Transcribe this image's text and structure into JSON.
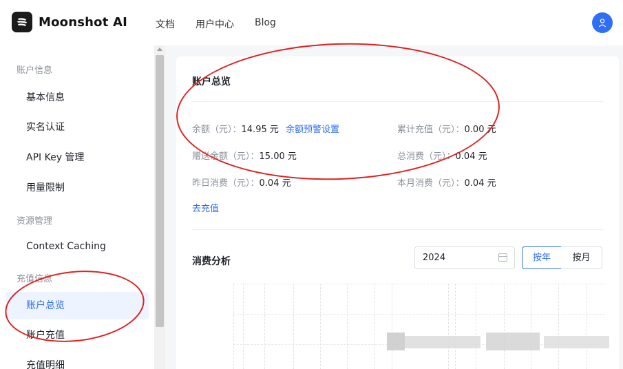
{
  "header": {
    "brand": "Moonshot AI",
    "nav": [
      {
        "label": "文档"
      },
      {
        "label": "用户中心"
      },
      {
        "label": "Blog"
      }
    ],
    "avatar_icon": "user-icon"
  },
  "sidebar": {
    "groups": [
      {
        "title": "账户信息",
        "items": [
          {
            "label": "基本信息"
          },
          {
            "label": "实名认证"
          },
          {
            "label": "API Key 管理"
          },
          {
            "label": "用量限制"
          }
        ]
      },
      {
        "title": "资源管理",
        "items": [
          {
            "label": "Context Caching"
          }
        ]
      },
      {
        "title": "充值信息",
        "items": [
          {
            "label": "账户总览",
            "active": true
          },
          {
            "label": "账户充值"
          },
          {
            "label": "充值明细"
          }
        ]
      }
    ]
  },
  "overview": {
    "title": "账户总览",
    "balance_label": "余额（元）：",
    "balance_value": "14.95 元",
    "balance_alert_link": "余额预警设置",
    "gift_balance_label": "赠送余额（元）：",
    "gift_balance_value": "15.00 元",
    "yesterday_label": "昨日消费（元）：",
    "yesterday_value": "0.04 元",
    "total_recharge_label": "累计充值（元）：",
    "total_recharge_value": "0.00 元",
    "total_consume_label": "总消费（元）：",
    "total_consume_value": "0.04 元",
    "month_label": "本月消费（元）：",
    "month_value": "0.04 元",
    "recharge_link": "去充值"
  },
  "analysis": {
    "title": "消费分析",
    "year_value": "2024",
    "btn_year": "按年",
    "btn_month": "按月"
  },
  "colors": {
    "accent": "#2f6ff4",
    "annotation": "#e02020"
  }
}
